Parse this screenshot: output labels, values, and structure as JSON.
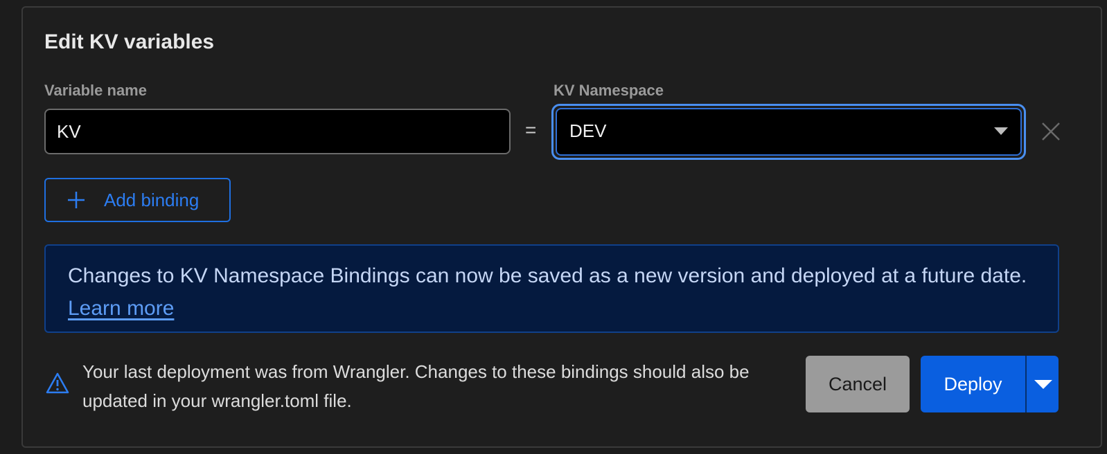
{
  "dialog": {
    "title": "Edit KV variables",
    "variable_label": "Variable name",
    "namespace_label": "KV Namespace"
  },
  "binding": {
    "variable_name": "KV",
    "equals": "=",
    "namespace": "DEV"
  },
  "actions": {
    "add_binding": "Add binding",
    "cancel": "Cancel",
    "deploy": "Deploy"
  },
  "info": {
    "text": "Changes to KV Namespace Bindings can now be saved as a new version and deployed at a future date.",
    "link": "Learn more"
  },
  "warning": {
    "text": "Your last deployment was from Wrangler. Changes to these bindings should also be updated in your wrangler.toml file."
  },
  "colors": {
    "accent": "#0a5fe0",
    "info_background": "#051a3f",
    "focus_ring": "#4a8ff0"
  },
  "icons": [
    "close-icon",
    "plus-icon",
    "warning-icon",
    "caret-down-icon"
  ]
}
